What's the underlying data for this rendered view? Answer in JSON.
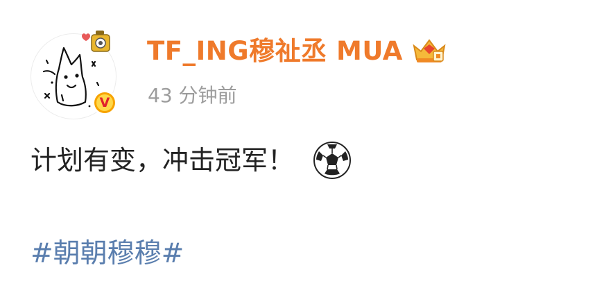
{
  "post": {
    "author": {
      "username": "TF_ING穆祉丞 MUA",
      "verified_badge_label": "V",
      "vip_icon": "crown-badge-icon"
    },
    "timestamp": "43 分钟前",
    "content": {
      "text": "计划有变，冲击冠军！",
      "emoji_icon": "soccer-ball-icon",
      "hashtag": "#朝朝穆穆#"
    }
  },
  "colors": {
    "username": "#ef7a2b",
    "timestamp": "#9c9c9c",
    "body_text": "#222222",
    "hashtag": "#5a7eae",
    "verified_badge": "#f7a300"
  }
}
